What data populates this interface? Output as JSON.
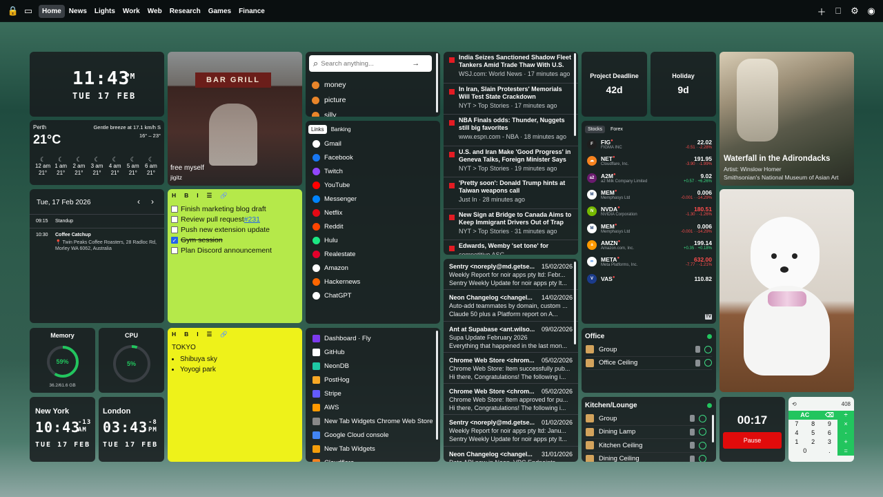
{
  "nav": {
    "tabs": [
      "Home",
      "News",
      "Lights",
      "Work",
      "Web",
      "Research",
      "Games",
      "Finance"
    ],
    "active": "Home"
  },
  "clock_main": {
    "time": "11:43",
    "ampm": "PM",
    "date": "TUE 17 FEB"
  },
  "weather": {
    "city": "Perth",
    "desc": "Gentle breeze at 17.1 km/h S",
    "temp": "21°C",
    "range": "16° – 23°",
    "hours": [
      {
        "h": "12 am",
        "t": "21°"
      },
      {
        "h": "1 am",
        "t": "21°"
      },
      {
        "h": "2 am",
        "t": "21°"
      },
      {
        "h": "3 am",
        "t": "21°"
      },
      {
        "h": "4 am",
        "t": "21°"
      },
      {
        "h": "5 am",
        "t": "21°"
      },
      {
        "h": "6 am",
        "t": "21°"
      }
    ]
  },
  "photo1": {
    "caption": "free myself",
    "author": "jigitz",
    "sign": "BAR GRILL"
  },
  "calendar": {
    "date": "Tue, 17 Feb 2026",
    "events": [
      {
        "time": "09:15",
        "title": "Standup",
        "loc": ""
      },
      {
        "time": "10:30",
        "title": "Coffee Catchup",
        "loc": "Twin Peaks Coffee Roasters, 28 Radloc Rd, Morley WA 6062, Australia"
      }
    ]
  },
  "memory": {
    "label": "Memory",
    "pct": "59%",
    "detail": "36.2/61.6 GB",
    "value": 0.59
  },
  "cpu": {
    "label": "CPU",
    "pct": "5%",
    "value": 0.05
  },
  "clocks": [
    {
      "city": "New York",
      "time": "10:43",
      "off": "-13",
      "ampm": "AM",
      "date": "TUE 17 FEB"
    },
    {
      "city": "London",
      "time": "03:43",
      "off": "-8",
      "ampm": "PM",
      "date": "TUE 17 FEB"
    }
  ],
  "note1": {
    "toolbar": [
      "H",
      "B",
      "I",
      "☰",
      "🔗"
    ],
    "items": [
      {
        "text": "Finish marketing blog draft",
        "done": false
      },
      {
        "text": "Review pull request ",
        "link": "#231",
        "done": false
      },
      {
        "text": "Push new extension update",
        "done": false
      },
      {
        "text": "Gym session",
        "done": true
      },
      {
        "text": "Plan Discord announcement",
        "done": false
      }
    ]
  },
  "note2": {
    "toolbar": [
      "H",
      "B",
      "I",
      "☰",
      "🔗"
    ],
    "title": "TOKYO",
    "items": [
      "Shibuya sky",
      "Yoyogi park"
    ]
  },
  "search": {
    "placeholder": "Search anything...",
    "suggestions": [
      "money",
      "picture",
      "silly"
    ]
  },
  "links": {
    "tabs": [
      "Links",
      "Banking"
    ],
    "items": [
      "Gmail",
      "Facebook",
      "Twitch",
      "YouTube",
      "Messenger",
      "Netflix",
      "Reddit",
      "Hulu",
      "Realestate",
      "Amazon",
      "Hackernews",
      "ChatGPT"
    ]
  },
  "links2": {
    "items": [
      "Dashboard · Fly",
      "GitHub",
      "NeonDB",
      "PostHog",
      "Stripe",
      "AWS",
      "New Tab Widgets Chrome Web Store",
      "Google Cloud console",
      "New Tab Widgets",
      "Cloudflare"
    ]
  },
  "news": [
    {
      "title": "India Seizes Sanctioned Shadow Fleet Tankers Amid Trade Thaw With U.S.",
      "meta": "WSJ.com: World News · 17 minutes ago"
    },
    {
      "title": "In Iran, Slain Protesters' Memorials Will Test State Crackdown",
      "meta": "NYT > Top Stories · 17 minutes ago"
    },
    {
      "title": "NBA Finals odds: Thunder, Nuggets still big favorites",
      "meta": "www.espn.com - NBA · 18 minutes ago"
    },
    {
      "title": "U.S. and Iran Make 'Good Progress' in Geneva Talks, Foreign Minister Says",
      "meta": "NYT > Top Stories · 19 minutes ago"
    },
    {
      "title": "'Pretty soon': Donald Trump hints at Taiwan weapons call",
      "meta": "Just In · 28 minutes ago"
    },
    {
      "title": "New Sign at Bridge to Canada Aims to Keep Immigrant Drivers Out of Trap",
      "meta": "NYT > Top Stories · 31 minutes ago"
    },
    {
      "title": "Edwards, Wemby 'set tone' for",
      "meta": "competitive ASG"
    }
  ],
  "mail": [
    {
      "from": "Sentry <noreply@md.getse...",
      "date": "15/02/2026",
      "subject": "Weekly Report for noir apps pty ltd: Febr...",
      "body": "Sentry Weekly Update for noir apps pty lt..."
    },
    {
      "from": "Neon Changelog <changel...",
      "date": "14/02/2026",
      "subject": "Auto-add teammates by domain, custom ...",
      "body": "Claude 50 plus a Platform report on A..."
    },
    {
      "from": "Ant at Supabase <ant.wilso...",
      "date": "09/02/2026",
      "subject": "Supa Update February 2026",
      "body": "Everything that happened in the last mon..."
    },
    {
      "from": "Chrome Web Store <chrom...",
      "date": "05/02/2026",
      "subject": "Chrome Web Store: Item successfully pub...",
      "body": "Hi there, Congratulations! The following i..."
    },
    {
      "from": "Chrome Web Store <chrom...",
      "date": "05/02/2026",
      "subject": "Chrome Web Store: Item approved for pu...",
      "body": "Hi there, Congratulations! The following i..."
    },
    {
      "from": "Sentry <noreply@md.getse...",
      "date": "01/02/2026",
      "subject": "Weekly Report for noir apps pty ltd: Janu...",
      "body": "Sentry Weekly Update for noir apps pty lt..."
    },
    {
      "from": "Neon Changelog <changel...",
      "date": "31/01/2026",
      "subject": "Data API now in Neon, VPC Endpoints...",
      "body": ""
    }
  ],
  "countdowns": [
    {
      "label": "Project Deadline",
      "value": "42d"
    },
    {
      "label": "Holiday",
      "value": "9d"
    }
  ],
  "stocks": {
    "tabs": [
      "Stocks",
      "Forex"
    ],
    "items": [
      {
        "sym": "FIG",
        "name": "FIGMA INC",
        "price": "22.02",
        "chg": "-0.51 · -2.28%",
        "up": false,
        "color": "#1e1e1e",
        "fg": "#fff",
        "abbr": "F"
      },
      {
        "sym": "NET",
        "name": "Cloudflare, Inc.",
        "price": "191.95",
        "chg": "-3.90 · -1.99%",
        "up": false,
        "color": "#f6821f",
        "fg": "#fff",
        "abbr": "☁"
      },
      {
        "sym": "A2M",
        "name": "a2 Milk Company Limited",
        "price": "9.02",
        "chg": "+0.57 · +6.26%",
        "up": true,
        "color": "#6a1b6e",
        "fg": "#fff",
        "abbr": "a2"
      },
      {
        "sym": "MEM",
        "name": "Memphasys Ltd",
        "price": "0.006",
        "chg": "-0.001 · -14.29%",
        "up": false,
        "color": "#ffffff",
        "fg": "#1a3b6e",
        "abbr": "M"
      },
      {
        "sym": "NVDA",
        "name": "NVIDIA Corporation",
        "price": "180.51",
        "chg": "-1.30 · -1.26%",
        "up": false,
        "color": "#76b900",
        "fg": "#fff",
        "abbr": "N"
      },
      {
        "sym": "MEM",
        "name": "Memphasys Ltd",
        "price": "0.006",
        "chg": "-0.001 · -14.29%",
        "up": false,
        "color": "#ffffff",
        "fg": "#1a3b6e",
        "abbr": "M"
      },
      {
        "sym": "AMZN",
        "name": "Amazon.com, Inc.",
        "price": "199.14",
        "chg": "+0.35 · +0.18%",
        "up": true,
        "color": "#ff9900",
        "fg": "#fff",
        "abbr": "a"
      },
      {
        "sym": "META",
        "name": "Meta Platforms, Inc.",
        "price": "632.00",
        "chg": "-7.77 · -1.21%",
        "up": false,
        "color": "#ffffff",
        "fg": "#0668e1",
        "abbr": "∞"
      },
      {
        "sym": "VAS",
        "name": "",
        "price": "110.82",
        "chg": "",
        "up": true,
        "color": "#1b3b8a",
        "fg": "#fff",
        "abbr": "V"
      }
    ]
  },
  "home1": {
    "title": "Office",
    "rows": [
      "Group",
      "Office Ceiling"
    ]
  },
  "home2": {
    "title": "Kitchen/Lounge",
    "rows": [
      "Group",
      "Dining Lamp",
      "Kitchen Ceiling",
      "Dining Ceiling"
    ]
  },
  "art": {
    "title": "Waterfall in the Adirondacks",
    "artist": "Artist: Winslow Homer",
    "museum": "Smithsonian's National Museum of Asian Art"
  },
  "timer": {
    "time": "00:17",
    "button": "Pause"
  },
  "calculator": {
    "display": "408",
    "keys": [
      "AC",
      "⌫",
      "÷",
      "7",
      "8",
      "9",
      "×",
      "4",
      "5",
      "6",
      "-",
      "1",
      "2",
      "3",
      "+",
      "0",
      ".",
      "="
    ]
  }
}
